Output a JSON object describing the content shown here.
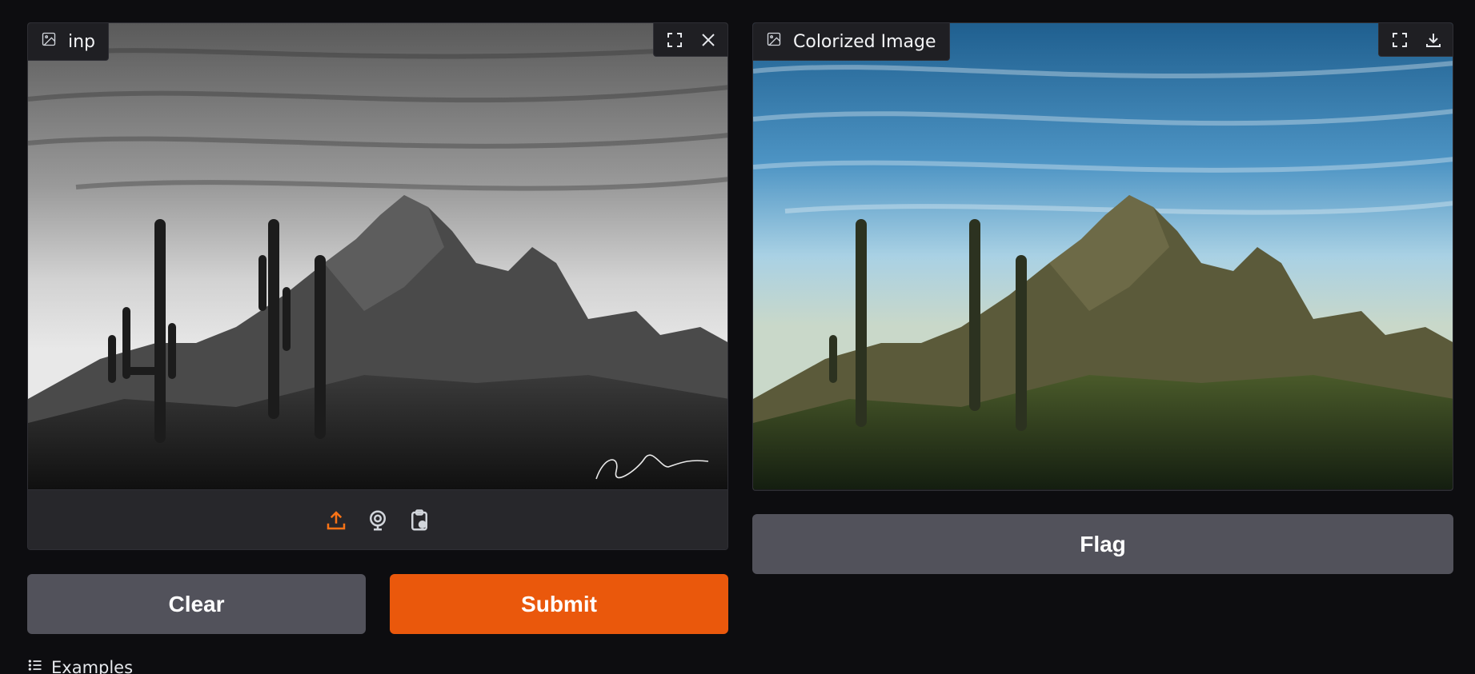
{
  "input_panel": {
    "label": "inp",
    "signature_text": "Jess Lee",
    "icons": {
      "label_icon": "image-icon",
      "fullscreen": "fullscreen-icon",
      "clear": "close-icon",
      "upload": "upload-icon",
      "webcam": "webcam-icon",
      "clipboard": "clipboard-paste-icon"
    }
  },
  "output_panel": {
    "label": "Colorized Image",
    "icons": {
      "label_icon": "image-icon",
      "fullscreen": "fullscreen-icon",
      "download": "download-icon"
    }
  },
  "buttons": {
    "clear": "Clear",
    "submit": "Submit",
    "flag": "Flag"
  },
  "examples": {
    "label": "Examples",
    "icon": "list-icon"
  },
  "colors": {
    "accent": "#ea580c",
    "secondary_button": "#52525b",
    "upload_icon_active": "#f97316"
  }
}
